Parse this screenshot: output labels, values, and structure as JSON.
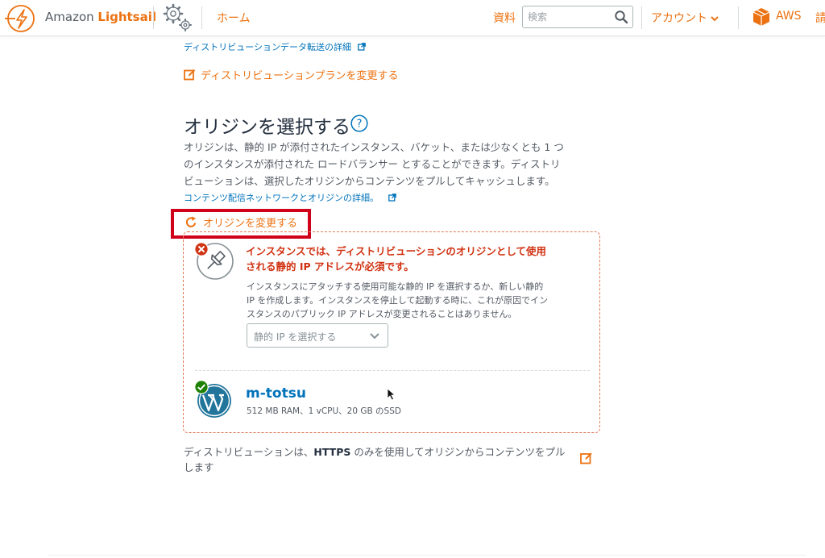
{
  "header": {
    "logo_prefix": "Amazon ",
    "logo_brand": "Lightsail",
    "home": "ホーム",
    "docs": "資料",
    "search_placeholder": "検索",
    "account": "アカウント",
    "aws": "AWS",
    "overflow": "請"
  },
  "colors": {
    "accent": "#ec7211",
    "link": "#0073bb",
    "error": "#d13212",
    "highlight": "#d0021b",
    "success": "#1d8102"
  },
  "links": {
    "transfer_details": "ディストリビューションデータ転送の詳細",
    "change_plan": "ディストリビューションプランを変更する"
  },
  "origin_section": {
    "title": "オリジンを選択する",
    "desc_line1": "オリジンは、静的 IP が添付されたインスタンス、バケット、または少なくとも 1 つ",
    "desc_line2": "のインスタンスが添付された ロードバランサー とすることができます。ディストリ",
    "desc_line3": "ビューションは、選択したオリジンからコンテンツをプルしてキャッシュします。",
    "learn_more": "コンテンツ配信ネットワークとオリジンの詳細。",
    "change_origin": "オリジンを変更する"
  },
  "origin_card": {
    "error_line1": "インスタンスでは、ディストリビューションのオリジンとして使用",
    "error_line2": "される静的 IP アドレスが必須です。",
    "body_line1": "インスタンスにアタッチする使用可能な静的 IP を選択するか、新しい静的",
    "body_line2": "IP を作成します。インスタンスを停止して起動する時に、これが原因でイン",
    "body_line3": "スタンスのパブリック IP アドレスが変更されることはありません。",
    "select_label": "静的 IP を選択する",
    "instance_name": "m-totsu",
    "instance_spec": "512 MB RAM、1 vCPU、20 GB のSSD"
  },
  "https": {
    "before": "ディストリビューションは、",
    "bold": "HTTPS",
    "after_line1": " のみを使用してオリジンからコンテンツをプル",
    "line2": "します"
  }
}
